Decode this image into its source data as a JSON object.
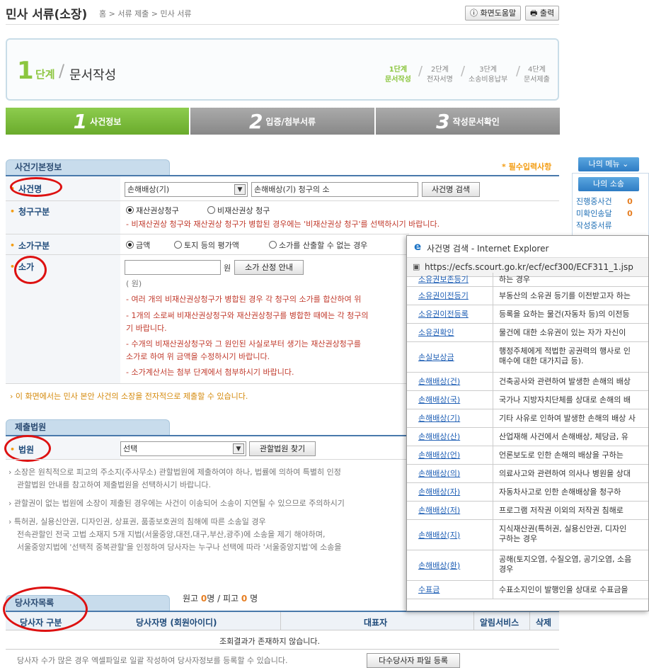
{
  "header": {
    "title": "민사 서류(소장)",
    "breadcrumb": "홈 > 서류 제출 > 민사 서류",
    "help_label": "화면도움말",
    "print_label": "출력"
  },
  "step_banner": {
    "num": "1",
    "word": "단계",
    "title": "문서작성",
    "steps": [
      {
        "top": "1단계",
        "bottom": "문서작성"
      },
      {
        "top": "2단계",
        "bottom": "전자서명"
      },
      {
        "top": "3단계",
        "bottom": "소송비용납부"
      },
      {
        "top": "4단계",
        "bottom": "문서제출"
      }
    ]
  },
  "tabs": [
    {
      "num": "1",
      "label": "사건정보"
    },
    {
      "num": "2",
      "label": "입증/첨부서류"
    },
    {
      "num": "3",
      "label": "작성문서확인"
    }
  ],
  "basic": {
    "section": "사건기본정보",
    "required_note": "* 필수입력사항",
    "case_name_label": "사건명",
    "case_select": "손해배상(기)",
    "case_value": "손해배상(기) 청구의 소",
    "case_search_btn": "사건명 검색",
    "claim_label": "청구구분",
    "claim_opt1": "재산권상청구",
    "claim_opt2": "비재산권상 청구",
    "claim_note": "- 비재산권상 청구와 재산권상 청구가 병합된 경우에는 '비재산권상 청구'를 선택하시기 바랍니다.",
    "value_type_label": "소가구분",
    "vt1": "금액",
    "vt2": "토지 등의 평가액",
    "vt3": "소가를 산출할 수 없는 경우",
    "value_label": "소가",
    "won": "원",
    "calc_btn": "소가 산정 안내",
    "won_paren": "( 원)",
    "n1": "- 여러 개의 비재산권상청구가 병합된 경우 각 청구의 소가를 합산하여 위",
    "n2": "- 1개의 소로써 비재산권상청구와 재산권상청구를 병합한 때에는 각 청구의",
    "n2b": "기 바랍니다.",
    "n3": "- 수개의 비재산권상청구와 그 원인된 사실로부터 생기는 재산권상청구를",
    "n3b": "소가로 하여 위 금액을 수정하시기 바랍니다.",
    "n4": "- 소가계산서는 첨부 단계에서 첨부하시기 바랍니다.",
    "info": "이 화면에서는 민사 본안 사건의 소장을 전자적으로 제출할 수 있습니다."
  },
  "court": {
    "section": "제출법원",
    "label": "법원",
    "select": "선택",
    "find_btn": "관할법원 찾기",
    "g1": "소장은 원칙적으로 피고의 주소지(주사무소) 관할법원에 제출하여야 하나, 법률에 의하여 특별히 인정",
    "g1b": "관할법원 안내를 참고하여 제출법원을 선택하시기 바랍니다.",
    "g2": "관할권이 없는 법원에 소장이 제출된 경우에는 사건이 이송되어 소송이 지연될 수 있으므로 주의하시기",
    "g3": "특허권, 실용신안권, 디자인권, 상표권, 품종보호권의 침해에 따른 소송일 경우",
    "g3b": "전속관할인 전국 고법 소재지 5개 지법(서울중앙,대전,대구,부산,광주)에 소송을 제기 해야하며,",
    "g3c": "서울중앙지법에 '선택적 중복관할'을 인정하여 당사자는 누구나 선택에 따라 '서울중앙지법'에 소송을"
  },
  "parties": {
    "section": "당사자목록",
    "count_plaintiff_label": "원고",
    "count_plaintiff": "0",
    "count_defendant_label": "피고",
    "count_defendant": "0",
    "unit": "명",
    "cols": [
      "당사자 구분",
      "당사자명 (회원아이디)",
      "대표자",
      "알림서비스",
      "삭제"
    ],
    "empty": "조회결과가 존재하지 않습니다.",
    "foot": "당사자 수가 많은 경우 엑셀파일로 일괄 작성하여 당사자정보를 등록할 수 있습니다.",
    "foot_btn": "다수당사자 파일 등록"
  },
  "sidebar": {
    "my_menu": "나의 메뉴",
    "my_lawsuit": "나의 소송",
    "items": [
      {
        "label": "진행중사건",
        "count": "0"
      },
      {
        "label": "미확인송달",
        "count": "0"
      },
      {
        "label": "작성중서류",
        "count": ""
      }
    ]
  },
  "popup": {
    "title": "사건명 검색 - Internet Explorer",
    "url": "https://ecfs.scourt.go.kr/ecf/ecf300/ECF311_1.jsp",
    "rows": [
      {
        "name": "소유권보존등기",
        "desc": "하는 경우"
      },
      {
        "name": "소유권이전등기",
        "desc": "부동산의 소유권 등기를 이전받고자 하는"
      },
      {
        "name": "소유권이전등록",
        "desc": "등록을 요하는 물건(자동차 등)의 이전등"
      },
      {
        "name": "소유권확인",
        "desc": "물건에 대한 소유권이 있는 자가 자신이"
      },
      {
        "name": "손실보상금",
        "desc": "행정주체에게 적법한 공권력의 행사로 인",
        "desc2": "매수에 대한 대가지급 등)."
      },
      {
        "name": "손해배상(건)",
        "desc": "건축공사와 관련하여 발생한 손해의 배상"
      },
      {
        "name": "손해배상(국)",
        "desc": "국가나 지방자치단체를 상대로 손해의 배"
      },
      {
        "name": "손해배상(기)",
        "desc": "기타 사유로 인하여 발생한 손해의 배상 사"
      },
      {
        "name": "손해배상(산)",
        "desc": "산업재해 사건에서 손해배상, 체당금, 유"
      },
      {
        "name": "손해배상(언)",
        "desc": "언론보도로 인한 손해의 배상을 구하는"
      },
      {
        "name": "손해배상(의)",
        "desc": "의료사고와 관련하여 의사나 병원을 상대"
      },
      {
        "name": "손해배상(자)",
        "desc": "자동차사고로 인한 손해배상을 청구하"
      },
      {
        "name": "손해배상(저)",
        "desc": "프로그램 저작권 이외의 저작권 침해로"
      },
      {
        "name": "손해배상(지)",
        "desc": "지식재산권(특허권, 실용신안권, 디자인",
        "desc2": "구하는 경우"
      },
      {
        "name": "손해배상(환)",
        "desc": "공해(토지오염, 수질오염, 공기오염, 소음",
        "desc2": "경우"
      },
      {
        "name": "수표금",
        "desc": "수표소지인이 발행인을 상대로 수표금을"
      }
    ]
  }
}
